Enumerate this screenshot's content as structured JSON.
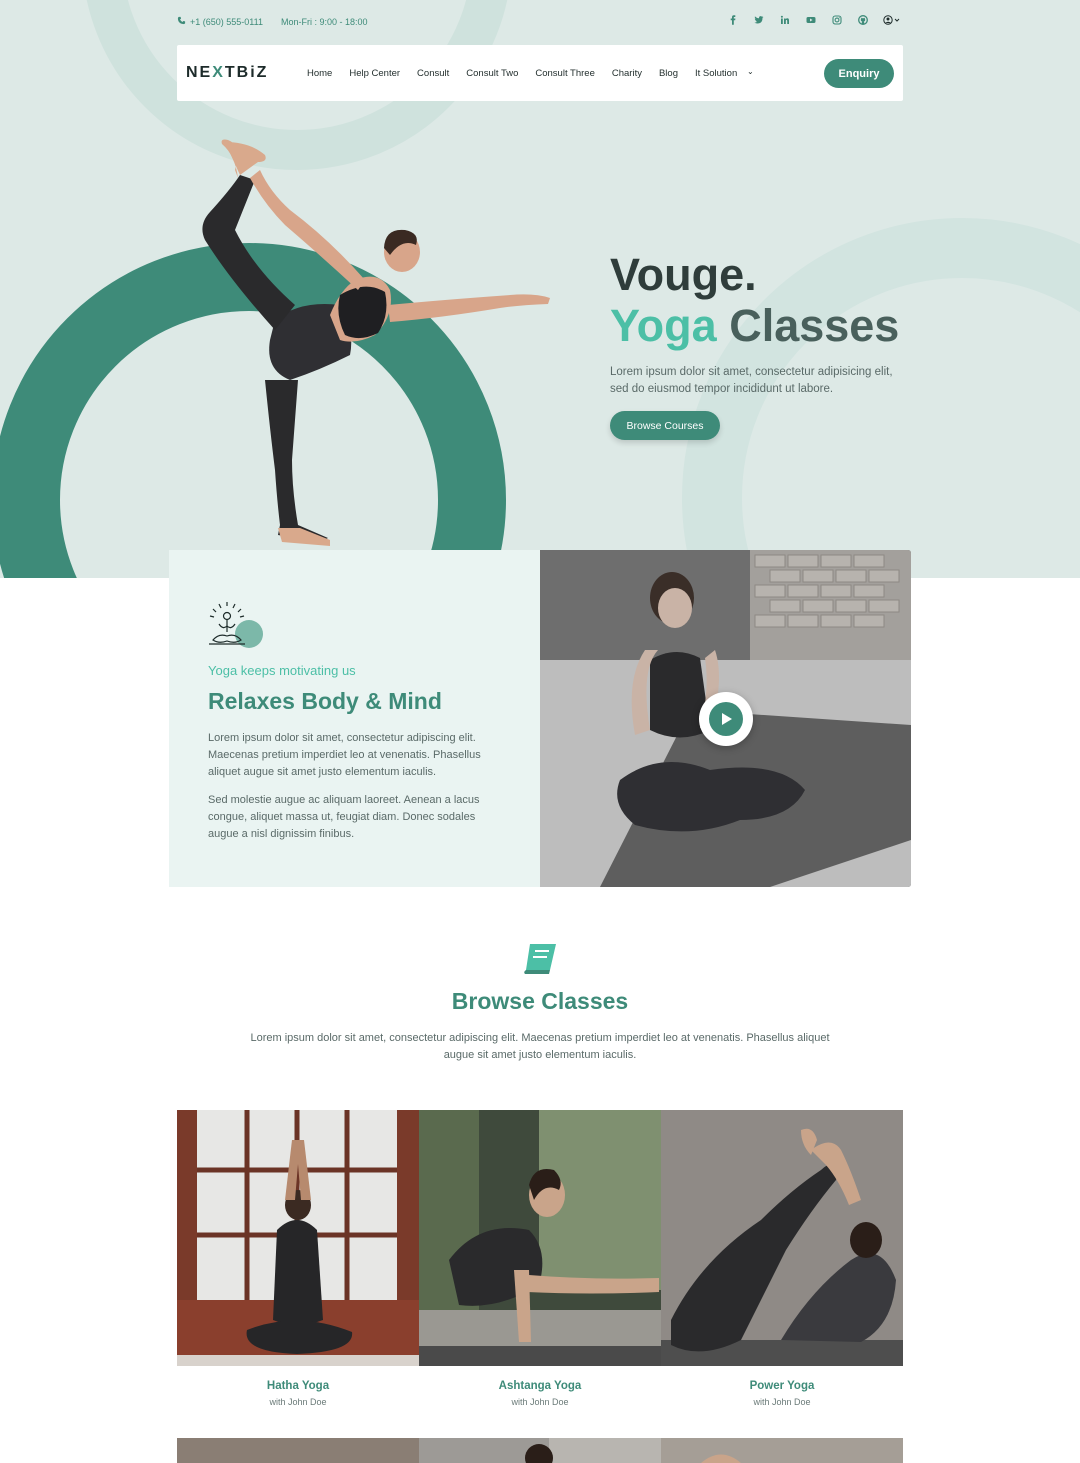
{
  "topbar": {
    "phone": "+1 (650) 555-0111",
    "hours": "Mon-Fri : 9:00 - 18:00",
    "social_icons": [
      "facebook-icon",
      "twitter-icon",
      "linkedin-icon",
      "youtube-icon",
      "instagram-icon",
      "github-icon",
      "user-icon"
    ]
  },
  "nav": {
    "logo_pre": "NE",
    "logo_x": "X",
    "logo_post": "TBiZ",
    "links": [
      "Home",
      "Help Center",
      "Consult",
      "Consult Two",
      "Consult Three",
      "Charity",
      "Blog",
      "It Solution"
    ],
    "more": "⌄",
    "enquiry": "Enquiry"
  },
  "hero": {
    "title_line1": "Vouge.",
    "title_accent": "Yoga",
    "title_rest": "Classes",
    "description": "Lorem ipsum dolor sit amet, consectetur adipisicing elit, sed do eiusmod tempor incididunt ut labore.",
    "button": "Browse Courses"
  },
  "feature": {
    "subtitle": "Yoga keeps motivating us",
    "title": "Relaxes Body & Mind",
    "paragraph1": "Lorem ipsum dolor sit amet, consectetur adipiscing elit. Maecenas pretium imperdiet leo at venenatis. Phasellus aliquet augue sit amet justo elementum iaculis.",
    "paragraph2": "Sed molestie augue ac aliquam laoreet. Aenean a lacus congue, aliquet massa ut, feugiat diam. Donec sodales augue a nisl dignissim finibus."
  },
  "classes": {
    "title": "Browse Classes",
    "description": "Lorem ipsum dolor sit amet, consectetur adipiscing elit. Maecenas pretium imperdiet leo at venenatis. Phasellus aliquet augue sit amet justo elementum iaculis.",
    "items": [
      {
        "name": "Hatha Yoga",
        "teacher": "with John Doe"
      },
      {
        "name": "Ashtanga Yoga",
        "teacher": "with John Doe"
      },
      {
        "name": "Power Yoga",
        "teacher": "with John Doe"
      }
    ]
  },
  "colors": {
    "accent": "#3e8b79",
    "accent_light": "#4cbfa6",
    "hero_bg": "#dde9e6",
    "card_bg": "#eaf4f2"
  }
}
